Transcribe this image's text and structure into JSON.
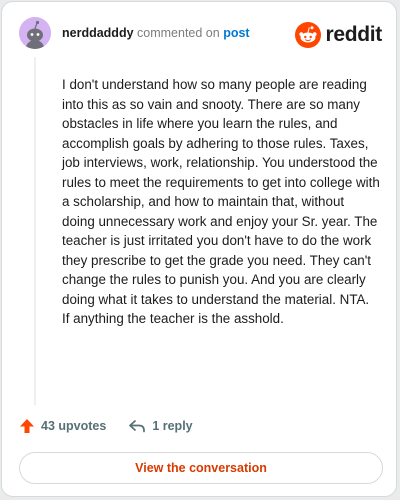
{
  "comment": {
    "username": "nerddadddy",
    "commented_on_text": "commented on",
    "post_link": "post",
    "body": "I don't understand how so many people are reading into this as so vain and snooty. There are so many obstacles in life where you learn the rules, and accomplish goals by adhering to those rules. Taxes, job interviews, work, relationship. You understood the rules to meet the requirements to get into college with a scholarship, and how to maintain that, without doing unnecessary work and enjoy your Sr. year. The teacher is just irritated you don't have to do the work they prescribe to get the grade you need. They can't change the rules to punish you. And you are clearly doing what it takes to understand the material. NTA. If anything the teacher is the asshold."
  },
  "brand": {
    "name": "reddit",
    "color": "#ff4500"
  },
  "footer": {
    "upvotes_label": "43 upvotes",
    "replies_label": "1 reply",
    "upvote_icon": "upvote-arrow-icon",
    "reply_icon": "reply-arrow-icon"
  },
  "actions": {
    "view_conversation_label": "View the conversation"
  },
  "colors": {
    "link": "#0079d3",
    "action": "#d93a00",
    "upvote": "#ff4500",
    "avatar_bg": "#d4b3f2"
  }
}
